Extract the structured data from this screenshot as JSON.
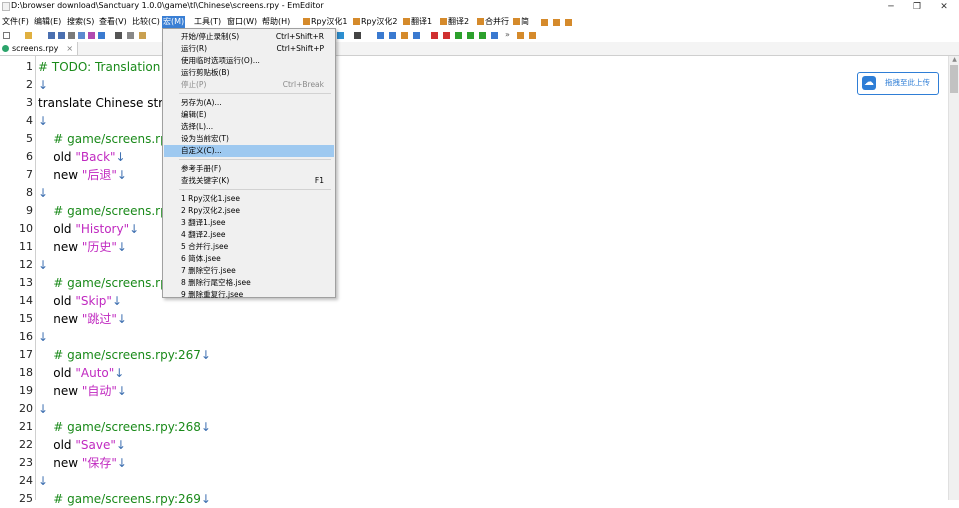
{
  "window": {
    "title": "D:\\browser download\\Sanctuary 1.0.0\\game\\tl\\Chinese\\screens.rpy - EmEditor",
    "minimize": "─",
    "maximize": "❐",
    "close": "✕"
  },
  "menubar": {
    "items": [
      {
        "label": "文件(F)"
      },
      {
        "label": "编辑(E)"
      },
      {
        "label": "搜索(S)"
      },
      {
        "label": "查看(V)"
      },
      {
        "label": "比较(C)"
      },
      {
        "label": "宏(M)"
      },
      {
        "label": "工具(T)"
      },
      {
        "label": "窗口(W)"
      },
      {
        "label": "帮助(H)"
      }
    ],
    "macro_buttons": [
      {
        "label": "Rpy汉化1"
      },
      {
        "label": "Rpy汉化2"
      },
      {
        "label": "翻译1"
      },
      {
        "label": "翻译2"
      },
      {
        "label": "合并行"
      },
      {
        "label": "简"
      }
    ]
  },
  "tab": {
    "label": "screens.rpy",
    "close": "×"
  },
  "editor": {
    "newline_mark": "↓",
    "lines": [
      {
        "num": "1",
        "segments": [
          {
            "t": "# TODO: Translation up",
            "c": "cmt"
          }
        ]
      },
      {
        "num": "2",
        "segments": []
      },
      {
        "num": "3",
        "segments": [
          {
            "t": "translate Chinese string",
            "c": "kw"
          }
        ]
      },
      {
        "num": "4",
        "segments": []
      },
      {
        "num": "5",
        "segments": [
          {
            "t": "    # game/screens.rpy:2",
            "c": "cmt"
          }
        ]
      },
      {
        "num": "6",
        "segments": [
          {
            "t": "    old ",
            "c": "kw"
          },
          {
            "t": "\"Back\"",
            "c": "str"
          }
        ]
      },
      {
        "num": "7",
        "segments": [
          {
            "t": "    new ",
            "c": "kw"
          },
          {
            "t": "\"后退\"",
            "c": "str"
          }
        ]
      },
      {
        "num": "8",
        "segments": []
      },
      {
        "num": "9",
        "segments": [
          {
            "t": "    # game/screens.rpy:2",
            "c": "cmt"
          }
        ]
      },
      {
        "num": "10",
        "segments": [
          {
            "t": "    old ",
            "c": "kw"
          },
          {
            "t": "\"History\"",
            "c": "str"
          }
        ]
      },
      {
        "num": "11",
        "segments": [
          {
            "t": "    new ",
            "c": "kw"
          },
          {
            "t": "\"历史\"",
            "c": "str"
          }
        ]
      },
      {
        "num": "12",
        "segments": []
      },
      {
        "num": "13",
        "segments": [
          {
            "t": "    # game/screens.rpy:2",
            "c": "cmt"
          }
        ]
      },
      {
        "num": "14",
        "segments": [
          {
            "t": "    old ",
            "c": "kw"
          },
          {
            "t": "\"Skip\"",
            "c": "str"
          }
        ]
      },
      {
        "num": "15",
        "segments": [
          {
            "t": "    new ",
            "c": "kw"
          },
          {
            "t": "\"跳过\"",
            "c": "str"
          }
        ]
      },
      {
        "num": "16",
        "segments": []
      },
      {
        "num": "17",
        "segments": [
          {
            "t": "    # game/screens.rpy:267",
            "c": "cmt"
          }
        ]
      },
      {
        "num": "18",
        "segments": [
          {
            "t": "    old ",
            "c": "kw"
          },
          {
            "t": "\"Auto\"",
            "c": "str"
          }
        ]
      },
      {
        "num": "19",
        "segments": [
          {
            "t": "    new ",
            "c": "kw"
          },
          {
            "t": "\"自动\"",
            "c": "str"
          }
        ]
      },
      {
        "num": "20",
        "segments": []
      },
      {
        "num": "21",
        "segments": [
          {
            "t": "    # game/screens.rpy:268",
            "c": "cmt"
          }
        ]
      },
      {
        "num": "22",
        "segments": [
          {
            "t": "    old ",
            "c": "kw"
          },
          {
            "t": "\"Save\"",
            "c": "str"
          }
        ]
      },
      {
        "num": "23",
        "segments": [
          {
            "t": "    new ",
            "c": "kw"
          },
          {
            "t": "\"保存\"",
            "c": "str"
          }
        ]
      },
      {
        "num": "24",
        "segments": []
      },
      {
        "num": "25",
        "segments": [
          {
            "t": "    # game/screens.rpy:269",
            "c": "cmt"
          }
        ]
      }
    ]
  },
  "macro_menu": {
    "groups": [
      [
        {
          "label": "开始/停止录制(S)",
          "shortcut": "Ctrl+Shift+R"
        },
        {
          "label": "运行(R)",
          "shortcut": "Ctrl+Shift+P"
        },
        {
          "label": "使用临时选项运行(O)...",
          "shortcut": ""
        },
        {
          "label": "运行剪贴板(B)",
          "shortcut": ""
        },
        {
          "label": "停止(P)",
          "shortcut": "Ctrl+Break",
          "disabled": true
        }
      ],
      [
        {
          "label": "另存为(A)...",
          "shortcut": ""
        },
        {
          "label": "编辑(E)",
          "shortcut": ""
        },
        {
          "label": "选择(L)...",
          "shortcut": ""
        },
        {
          "label": "设为当前宏(T)",
          "shortcut": ""
        },
        {
          "label": "自定义(C)...",
          "shortcut": "",
          "highlighted": true
        }
      ],
      [
        {
          "label": "参考手册(F)",
          "shortcut": ""
        },
        {
          "label": "查找关键字(K)",
          "shortcut": "F1"
        }
      ],
      [
        {
          "label": "1 Rpy汉化1.jsee",
          "shortcut": ""
        },
        {
          "label": "2 Rpy汉化2.jsee",
          "shortcut": ""
        },
        {
          "label": "3 翻译1.jsee",
          "shortcut": ""
        },
        {
          "label": "4 翻译2.jsee",
          "shortcut": ""
        },
        {
          "label": "5 合并行.jsee",
          "shortcut": ""
        },
        {
          "label": "6 简体.jsee",
          "shortcut": ""
        },
        {
          "label": "7 删除空行.jsee",
          "shortcut": ""
        },
        {
          "label": "8 删除行尾空格.jsee",
          "shortcut": ""
        },
        {
          "label": "9 删除重复行.jsee",
          "shortcut": ""
        }
      ]
    ]
  },
  "upload_button": {
    "label": "拖拽至此上传"
  },
  "colors": {
    "comment": "#1a8a1a",
    "string": "#c029c0",
    "menu_active": "#3a7fd4",
    "menu_highlight": "#9ec9f0",
    "upload_accent": "#2f7ed6"
  }
}
